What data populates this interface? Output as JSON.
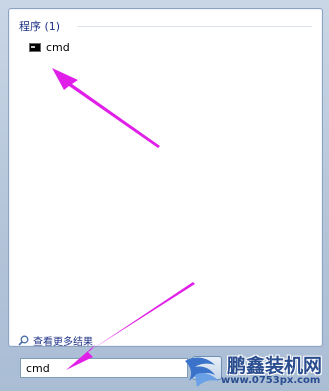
{
  "results": {
    "group_header": "程序 (1)",
    "items": [
      {
        "icon": "cmd-icon",
        "label": "cmd"
      }
    ]
  },
  "see_more": {
    "icon": "search-icon",
    "label": "查看更多结果"
  },
  "search": {
    "value": "cmd"
  },
  "watermark": {
    "title": "鹏鑫装机网",
    "url": "www.0753px.com"
  },
  "colors": {
    "annotation_arrow": "#e020e8",
    "header_text": "#1e3287",
    "watermark_text": "#2a4d8f"
  }
}
